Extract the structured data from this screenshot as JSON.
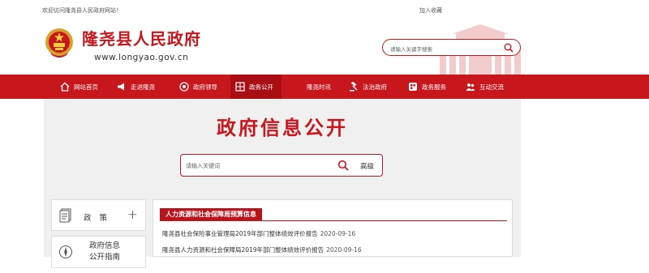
{
  "topbar": {
    "welcome": "欢迎访问隆尧县人民政府网站！",
    "favorite": "加入收藏"
  },
  "header": {
    "site_title": "隆尧县人民政府",
    "site_url": "www.longyao.gov.cn",
    "search_placeholder": "请输入关键字搜索"
  },
  "nav": {
    "items": [
      {
        "label": "网站首页",
        "icon": "home-icon"
      },
      {
        "label": "走进隆尧",
        "icon": "megaphone-icon"
      },
      {
        "label": "政府领导",
        "icon": "target-icon"
      },
      {
        "label": "政务公开",
        "icon": "grid-icon",
        "active": true
      },
      {
        "label": "隆尧时讯",
        "icon": "news-icon"
      },
      {
        "label": "法治政府",
        "icon": "gavel-icon"
      },
      {
        "label": "政务服务",
        "icon": "service-icon"
      },
      {
        "label": "互动交流",
        "icon": "people-icon"
      }
    ]
  },
  "main": {
    "page_title": "政府信息公开",
    "search_placeholder": "请输入关键词",
    "advanced_label": "高级"
  },
  "sidebar": {
    "items": [
      {
        "label": "政策",
        "icon": "document-icon",
        "plus": "+"
      },
      {
        "label_line1": "政府信息",
        "label_line2": "公开指南",
        "icon": "compass-icon"
      }
    ]
  },
  "content": {
    "section_title": "人力资源和社会保障局预算信息",
    "articles": [
      {
        "title": "隆尧县社会保险事业管理局2019年部门整体绩效评价报告",
        "date": "2020-09-16"
      },
      {
        "title": "隆尧县人力资源和社会保障局2019年部门整体绩效评价报告",
        "date": "2020-09-16"
      }
    ]
  },
  "colors": {
    "brand_red": "#c8161d",
    "nav_active": "#a90e15",
    "main_bg": "#f0f0f0"
  }
}
